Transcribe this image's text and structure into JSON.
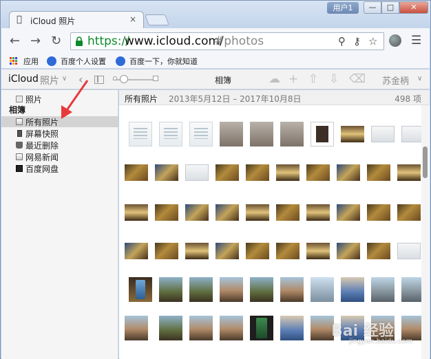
{
  "browser": {
    "tab_title": "iCloud 照片",
    "tab_close": "×",
    "user_badge": "用户1",
    "min_btn": "—",
    "max_btn": "□",
    "close_btn": "✕",
    "url_scheme": "https://",
    "url_host": "www.icloud.com/",
    "url_path": "#photos",
    "bookmarks": [
      "应用",
      "百度个人设置",
      "百度一下，你就知道"
    ]
  },
  "app": {
    "brand": "iCloud",
    "section": "照片",
    "title": "相簿",
    "user": "苏金柄"
  },
  "sidebar": {
    "top_item": "照片",
    "heading": "相簿",
    "items": [
      "所有照片",
      "屏幕快照",
      "最近删除",
      "网易新闻",
      "百度网盘"
    ],
    "selected_index": 0
  },
  "grid": {
    "title": "所有照片",
    "date_range": "2013年5月12日 – 2017年10月8日",
    "count": "498 项"
  },
  "watermark": {
    "main": "Bai 经验",
    "sub": "jingyan.baidu.com"
  },
  "colors": {
    "accent_arrow": "#e8393a",
    "url_green": "#0a8a2a",
    "selected_bg": "#d3d3d3"
  }
}
